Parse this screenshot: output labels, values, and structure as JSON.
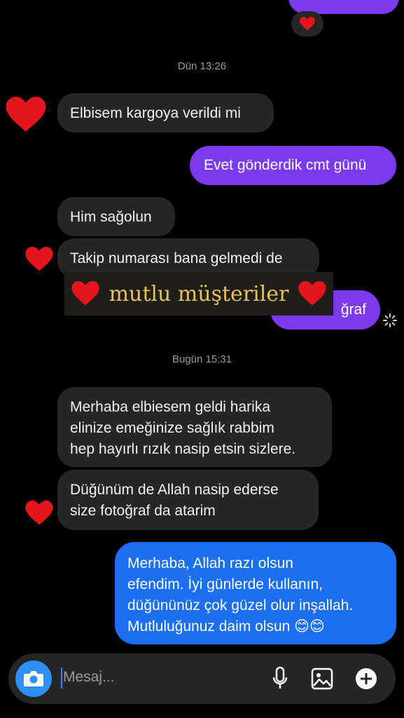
{
  "timestamps": {
    "yesterday": "Dün 13:26",
    "today": "Bugün 15:31"
  },
  "messages": {
    "m1": "Elbisem kargoya verildi mi",
    "m2": "Evet gönderdik cmt günü",
    "m3": "Him sağolun",
    "m4": "Takip numarası bana gelmedi de",
    "m5_partial": "ğraf",
    "m6": "Merhaba elbiesem geldi harika\nelinize emeğinize sağlık rabbim\nhep hayırlı rızık nasip etsin sizlere.",
    "m7": "Düğünüm de Allah nasip ederse\nsize fotoğraf da atarim",
    "m8": "Merhaba, Allah razı olsun\nefendim. İyi günlerde kullanın,\ndüğününüz çok güzel olur inşallah.\nMutluluğunuz daim olsun 😊😊"
  },
  "overlay": {
    "text": "mutlu müşteriler"
  },
  "composer": {
    "placeholder": "Mesaj..."
  },
  "icons": [
    "heart-icon",
    "camera-icon",
    "microphone-icon",
    "image-icon",
    "plus-icon",
    "loading-icon"
  ],
  "colors": {
    "outgoing": "#7c3aed",
    "incoming": "#262626",
    "reply": "#1d6ff2",
    "heart": "#e5141f",
    "banner_text": "#e7c25a"
  }
}
